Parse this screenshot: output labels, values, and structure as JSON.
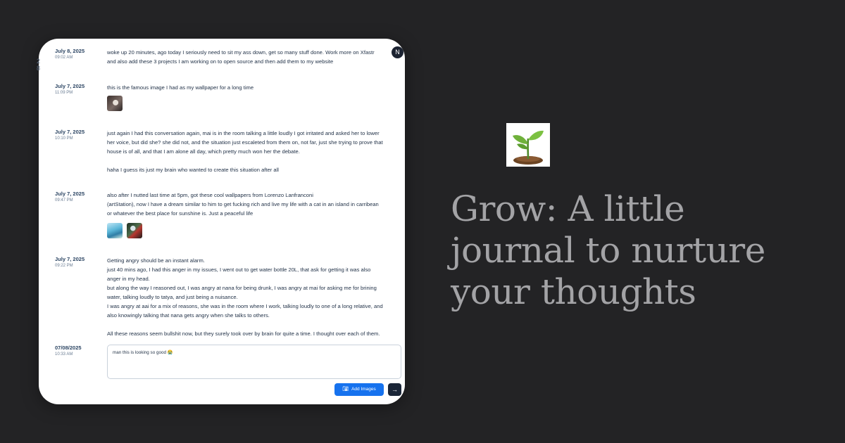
{
  "edge_chars": [
    "2",
    "8"
  ],
  "user_avatar": "N",
  "entries": [
    {
      "date": "July 8, 2025",
      "time": "09:02 AM",
      "paragraphs": [
        [
          "woke up 20 minutes, ago today I seriously need to sit my ass down, get so many stuff done. Work more on Xfastr",
          "and also add these 3 projects I am working on to open source and then add them to my website"
        ]
      ]
    },
    {
      "date": "July 7, 2025",
      "time": "11:09 PM",
      "paragraphs": [
        [
          "this is the famous image I had as my wallpaper for a long time"
        ]
      ]
    },
    {
      "date": "July 7, 2025",
      "time": "10:10 PM",
      "paragraphs": [
        [
          "just again I had this conversation again, mai is in the room talking a little loudly I got irritated and asked her to lower",
          "her voice, but did she? she did not, and the situation just escaleted from them on, not far, just she trying to prove that",
          "house is of all, and that I am alone all day, which pretty much won her the debate."
        ],
        [
          "haha I guess its just my brain who wanted to create this situation after all"
        ]
      ]
    },
    {
      "date": "July 7, 2025",
      "time": "09:47 PM",
      "paragraphs": [
        [
          "also after I nutted last time at 5pm, got these cool wallpapers from Lorenzo Lanfranconi",
          "(artStation), now I have a dream similar to him to get fucking rich and live my life with a cat in an island in carribean",
          "or whatever the best place for sunshine is. Just a peaceful life"
        ]
      ]
    },
    {
      "date": "July 7, 2025",
      "time": "09:22 PM",
      "paragraphs": [
        [
          "Getting angry should be an instant alarm.",
          "just 40 mins ago, I had this anger in my issues, I went out to get water bottle 20L, that ask for getting it was also",
          "anger in my head.",
          "but along the way I reasoned out, I was angry at nana for being drunk, I was angry at mai for asking me for brining",
          "water, talking loudly to tatya, and just being a nuisance.",
          "I was angry at aai for a mix of reasons, she was in the room where I work, talking loudly to one of a long relative, and",
          "also knowingly talking that nana gets angry when she talks to others."
        ],
        [
          "All these reasons seem bullshit now, but they surely took over by brain for quite a time. I thought over each of them."
        ]
      ]
    }
  ],
  "composer": {
    "date": "07/08/2025",
    "time": "10:33 AM",
    "draft": "man this is looking so good 😭"
  },
  "buttons": {
    "add_images": "Add Images",
    "send": "→"
  },
  "headline": "Grow: A little journal to nurture your thoughts",
  "colors": {
    "background": "#232325",
    "card": "#ffffff",
    "accent": "#1672ee",
    "headline": "#a3a3a6"
  },
  "icons": [
    "camera-icon",
    "arrow-right-icon",
    "sprout-logo"
  ]
}
